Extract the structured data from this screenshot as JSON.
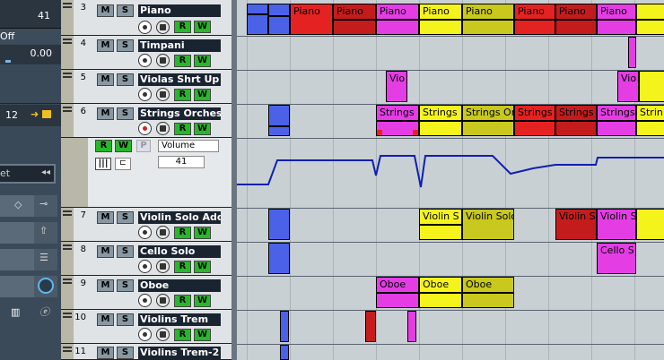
{
  "inspector": {
    "value1": "41",
    "off_label": "Off",
    "value2": "0.00",
    "value3": "12",
    "et_label": "et"
  },
  "tracks": [
    {
      "num": "3",
      "name": "Piano",
      "m": "M",
      "s": "S",
      "r": "R",
      "w": "W"
    },
    {
      "num": "4",
      "name": "Timpani",
      "m": "M",
      "s": "S",
      "r": "R",
      "w": "W"
    },
    {
      "num": "5",
      "name": "Violas Shrt Up Dr",
      "m": "M",
      "s": "S",
      "r": "R",
      "w": "W"
    },
    {
      "num": "6",
      "name": "Strings Orchestr",
      "m": "M",
      "s": "S",
      "r": "R",
      "w": "W"
    },
    {
      "num": "7",
      "name": "Violin Solo Add",
      "m": "M",
      "s": "S",
      "r": "R",
      "w": "W"
    },
    {
      "num": "8",
      "name": "Cello Solo",
      "m": "M",
      "s": "S",
      "r": "R",
      "w": "W"
    },
    {
      "num": "9",
      "name": "Oboe",
      "m": "M",
      "s": "S",
      "r": "R",
      "w": "W"
    },
    {
      "num": "10",
      "name": "Violins Trem",
      "m": "M",
      "s": "S",
      "r": "R",
      "w": "W"
    },
    {
      "num": "11",
      "name": "Violins Trem-2",
      "m": "M",
      "s": "S",
      "r": "R",
      "w": "W"
    }
  ],
  "automation": {
    "r": "R",
    "w": "W",
    "p": "P",
    "param": "Volume",
    "value": "41"
  },
  "clips": {
    "piano": [
      "Piano",
      "Piano",
      "Piano",
      "Piano",
      "Piano",
      "Piano",
      "Piano",
      "Piano"
    ],
    "violas": [
      "Vio",
      "Vio"
    ],
    "strings": [
      "Strings",
      "Strings",
      "Strings Or",
      "Strings",
      "Strings",
      "Strings",
      "Strin"
    ],
    "violin_solo": [
      "Violin S",
      "Violin Solo",
      "Violin S",
      "Violin S"
    ],
    "cello": [
      "Cello S"
    ],
    "oboe": [
      "Oboe",
      "Oboe",
      "Oboe"
    ]
  },
  "colors": {
    "red": "#e52222",
    "yellow": "#f4f41c",
    "magenta": "#e43de4",
    "blue": "#4b62e8",
    "olive": "#c8c81e",
    "darkred": "#c41c1c",
    "automation_line": "#1020b0"
  }
}
